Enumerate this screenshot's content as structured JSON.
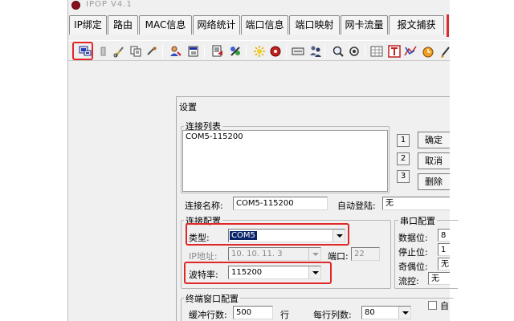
{
  "app": {
    "title": "IPOP V4.1"
  },
  "tabs": [
    "IP绑定",
    "路由",
    "MAC信息",
    "网络统计",
    "端口信息",
    "端口映射",
    "网卡流量",
    "报文捕获"
  ],
  "toolbar_icons": [
    "connect-icon",
    "book-icon",
    "cut-icon",
    "copy-icon",
    "paste-icon",
    "user-icon",
    "edit-icon",
    "document-icon",
    "tools-icon",
    "sun-icon",
    "record-icon",
    "list-icon",
    "users-icon",
    "zoom-icon",
    "refresh-icon",
    "grid-icon",
    "text-icon",
    "chart-icon",
    "timer-icon",
    "paint-icon"
  ],
  "dialog": {
    "title": "设置",
    "connection_list": {
      "label": "连接列表",
      "items": [
        "COM5-115200"
      ],
      "buttons": {
        "one": "1",
        "two": "2",
        "three": "3"
      },
      "side_buttons": {
        "confirm": "确定",
        "cancel": "取消",
        "delete": "删除"
      }
    },
    "name_label": "连接名称:",
    "name_value": "COM5-115200",
    "autologin_label": "自动登陆:",
    "autologin_value": "无",
    "conn_config": {
      "label": "连接配置",
      "type_label": "类型:",
      "type_value": "COM5",
      "ip_label": "IP地址:",
      "ip_value": "10. 10. 11. 3",
      "port_label": "端口:",
      "port_value": "22",
      "baud_label": "波特率:",
      "baud_value": "115200"
    },
    "serial_config": {
      "label": "串口配置",
      "databits_label": "数据位:",
      "databits_value": "8",
      "stopbits_label": "停止位:",
      "stopbits_value": "1",
      "parity_label": "奇偶位:",
      "parity_value": "无",
      "flow_label": "流控:",
      "flow_value": "无"
    },
    "terminal_config": {
      "label": "终端窗口配置",
      "buffer_label": "缓冲行数:",
      "buffer_value": "500",
      "buffer_unit": "行",
      "cols_label": "每行列数:",
      "cols_value": "80",
      "auto_label": "自"
    }
  },
  "colors": {
    "highlight": "#e02828",
    "selection": "#0a246a"
  }
}
